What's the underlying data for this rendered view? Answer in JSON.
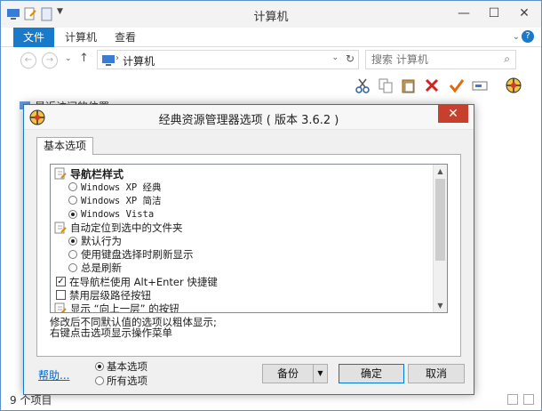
{
  "explorer": {
    "window_title": "计算机",
    "ribbon_tabs": [
      "文件",
      "计算机",
      "查看"
    ],
    "address": "计算机",
    "search_placeholder": "搜索 计算机",
    "left_pane_item": "最近访问的位置",
    "status_text": "9 个项目",
    "accent_color": "#1979ca"
  },
  "dialog": {
    "title": "经典资源管理器选项 ( 版本 3.6.2 )",
    "close_label": "✕",
    "tab_label": "基本选项",
    "options": [
      {
        "type": "group",
        "label": "导航栏样式",
        "bold": true,
        "font": "normal"
      },
      {
        "type": "radio",
        "label": "Windows XP 经典",
        "checked": false,
        "font": "mono"
      },
      {
        "type": "radio",
        "label": "Windows XP 简洁",
        "checked": false,
        "font": "mono"
      },
      {
        "type": "radio",
        "label": "Windows Vista",
        "checked": true,
        "font": "mono"
      },
      {
        "type": "group",
        "label": "自动定位到选中的文件夹",
        "bold": false,
        "font": "normal"
      },
      {
        "type": "radio",
        "label": "默认行为",
        "checked": true,
        "font": "normal"
      },
      {
        "type": "radio",
        "label": "使用键盘选择时刷新显示",
        "checked": false,
        "font": "normal"
      },
      {
        "type": "radio",
        "label": "总是刷新",
        "checked": false,
        "font": "normal"
      },
      {
        "type": "checkbox",
        "label": "在导航栏使用 Alt+Enter 快捷键",
        "checked": true,
        "font": "normal"
      },
      {
        "type": "checkbox",
        "label": "禁用层级路径按钮",
        "checked": false,
        "font": "normal"
      },
      {
        "type": "group",
        "label": "显示 “向上一层” 的按钮",
        "bold": false,
        "font": "normal"
      }
    ],
    "description_line1": "修改后不同默认值的选项以粗体显示;",
    "description_line2": "右键点击选项显示操作菜单",
    "help_link": "帮助...",
    "mode_options": [
      {
        "label": "基本选项",
        "checked": true
      },
      {
        "label": "所有选项",
        "checked": false
      }
    ],
    "backup_button": "备份",
    "ok_button": "确定",
    "cancel_button": "取消"
  }
}
